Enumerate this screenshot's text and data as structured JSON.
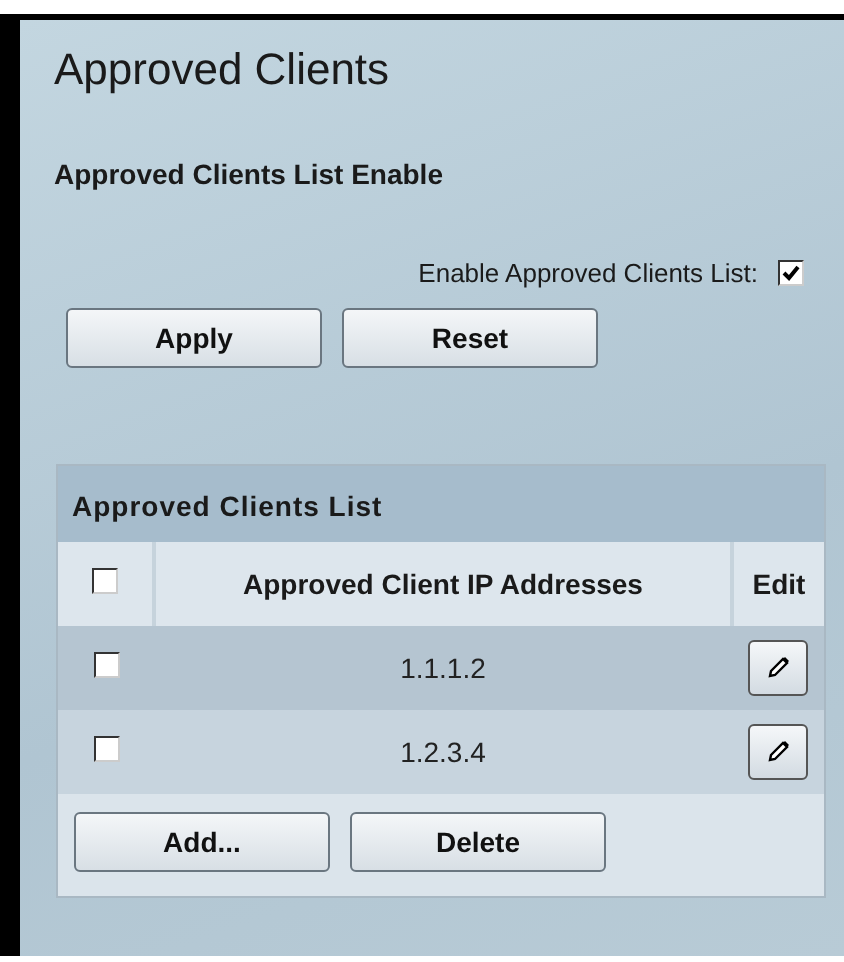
{
  "page": {
    "title": "Approved Clients"
  },
  "enable_section": {
    "heading": "Approved Clients List Enable",
    "label": "Enable Approved Clients List:",
    "checked": true
  },
  "buttons": [
    "Apply",
    "Reset"
  ],
  "table": {
    "title": "Approved Clients List",
    "select_all_checked": false,
    "columns": [
      "Approved Client IP Addresses",
      "Edit"
    ],
    "rows": [
      {
        "ip": "1.1.1.2",
        "checked": false
      },
      {
        "ip": "1.2.3.4",
        "checked": false
      }
    ]
  },
  "table_buttons": [
    "Add...",
    "Delete"
  ]
}
